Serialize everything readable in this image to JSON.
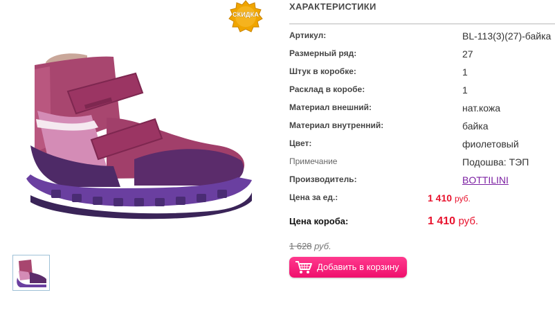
{
  "badge": {
    "label": "СКИДКА",
    "color": "#f0a500"
  },
  "product": {
    "image_icon": "boot-image",
    "thumbnail_icon": "boot-thumbnail"
  },
  "specs": {
    "title": "ХАРАКТЕРИСТИКИ",
    "rows": [
      {
        "label": "Артикул:",
        "value": "BL-113(3)(27)-байка"
      },
      {
        "label": "Размерный ряд:",
        "value": "27"
      },
      {
        "label": "Штук в коробке:",
        "value": "1"
      },
      {
        "label": "Расклад в коробе:",
        "value": "1"
      },
      {
        "label": "Материал внешний:",
        "value": "нат.кожа"
      },
      {
        "label": "Материал внутренний:",
        "value": "байка"
      },
      {
        "label": "Цвет:",
        "value": "фиолетовый"
      },
      {
        "label": "Примечание",
        "value": "Подошва: ТЭП"
      },
      {
        "label": "Производитель:",
        "value": "BOTTILINI"
      }
    ],
    "unit_price": {
      "label": "Цена за ед.:",
      "amount": "1 410",
      "currency": "руб."
    },
    "box_price": {
      "label": "Цена короба:",
      "amount": "1 410",
      "currency": "руб."
    },
    "old_price": {
      "amount": "1 628",
      "currency": "руб."
    }
  },
  "cart": {
    "label": "Добавить в корзину",
    "icon": "shopping-cart-icon",
    "color": "#ef0f6c"
  },
  "colors": {
    "price": "#e8132e",
    "link": "#7b1fa2"
  }
}
